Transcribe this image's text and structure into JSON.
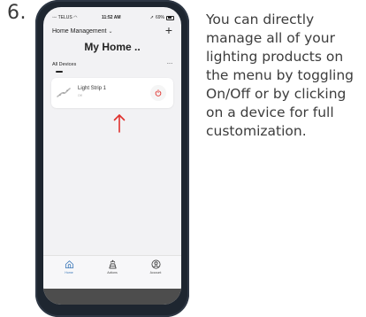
{
  "step": {
    "number": "6."
  },
  "instructions": "You can directly manage all of your lighting products on the menu by toggling On/Off or by clicking on a device for full customization.",
  "status_bar": {
    "carrier": "TELUS",
    "time": "11:52 AM",
    "battery": "69%"
  },
  "header": {
    "home_select": "Home Management",
    "page_title": "My Home .."
  },
  "devices": {
    "tab_label": "All Devices",
    "items": [
      {
        "name": "Light Strip 1",
        "status": "Off"
      }
    ]
  },
  "tabbar": {
    "items": [
      {
        "label": "Home",
        "icon": "home-icon",
        "active": true
      },
      {
        "label": "Actions",
        "icon": "actions-icon",
        "active": false
      },
      {
        "label": "Account",
        "icon": "account-icon",
        "active": false
      }
    ]
  },
  "colors": {
    "accent": "#3c78b8",
    "arrow": "#e0312d",
    "power": "#e0312d",
    "phone_body": "#1e2630"
  }
}
